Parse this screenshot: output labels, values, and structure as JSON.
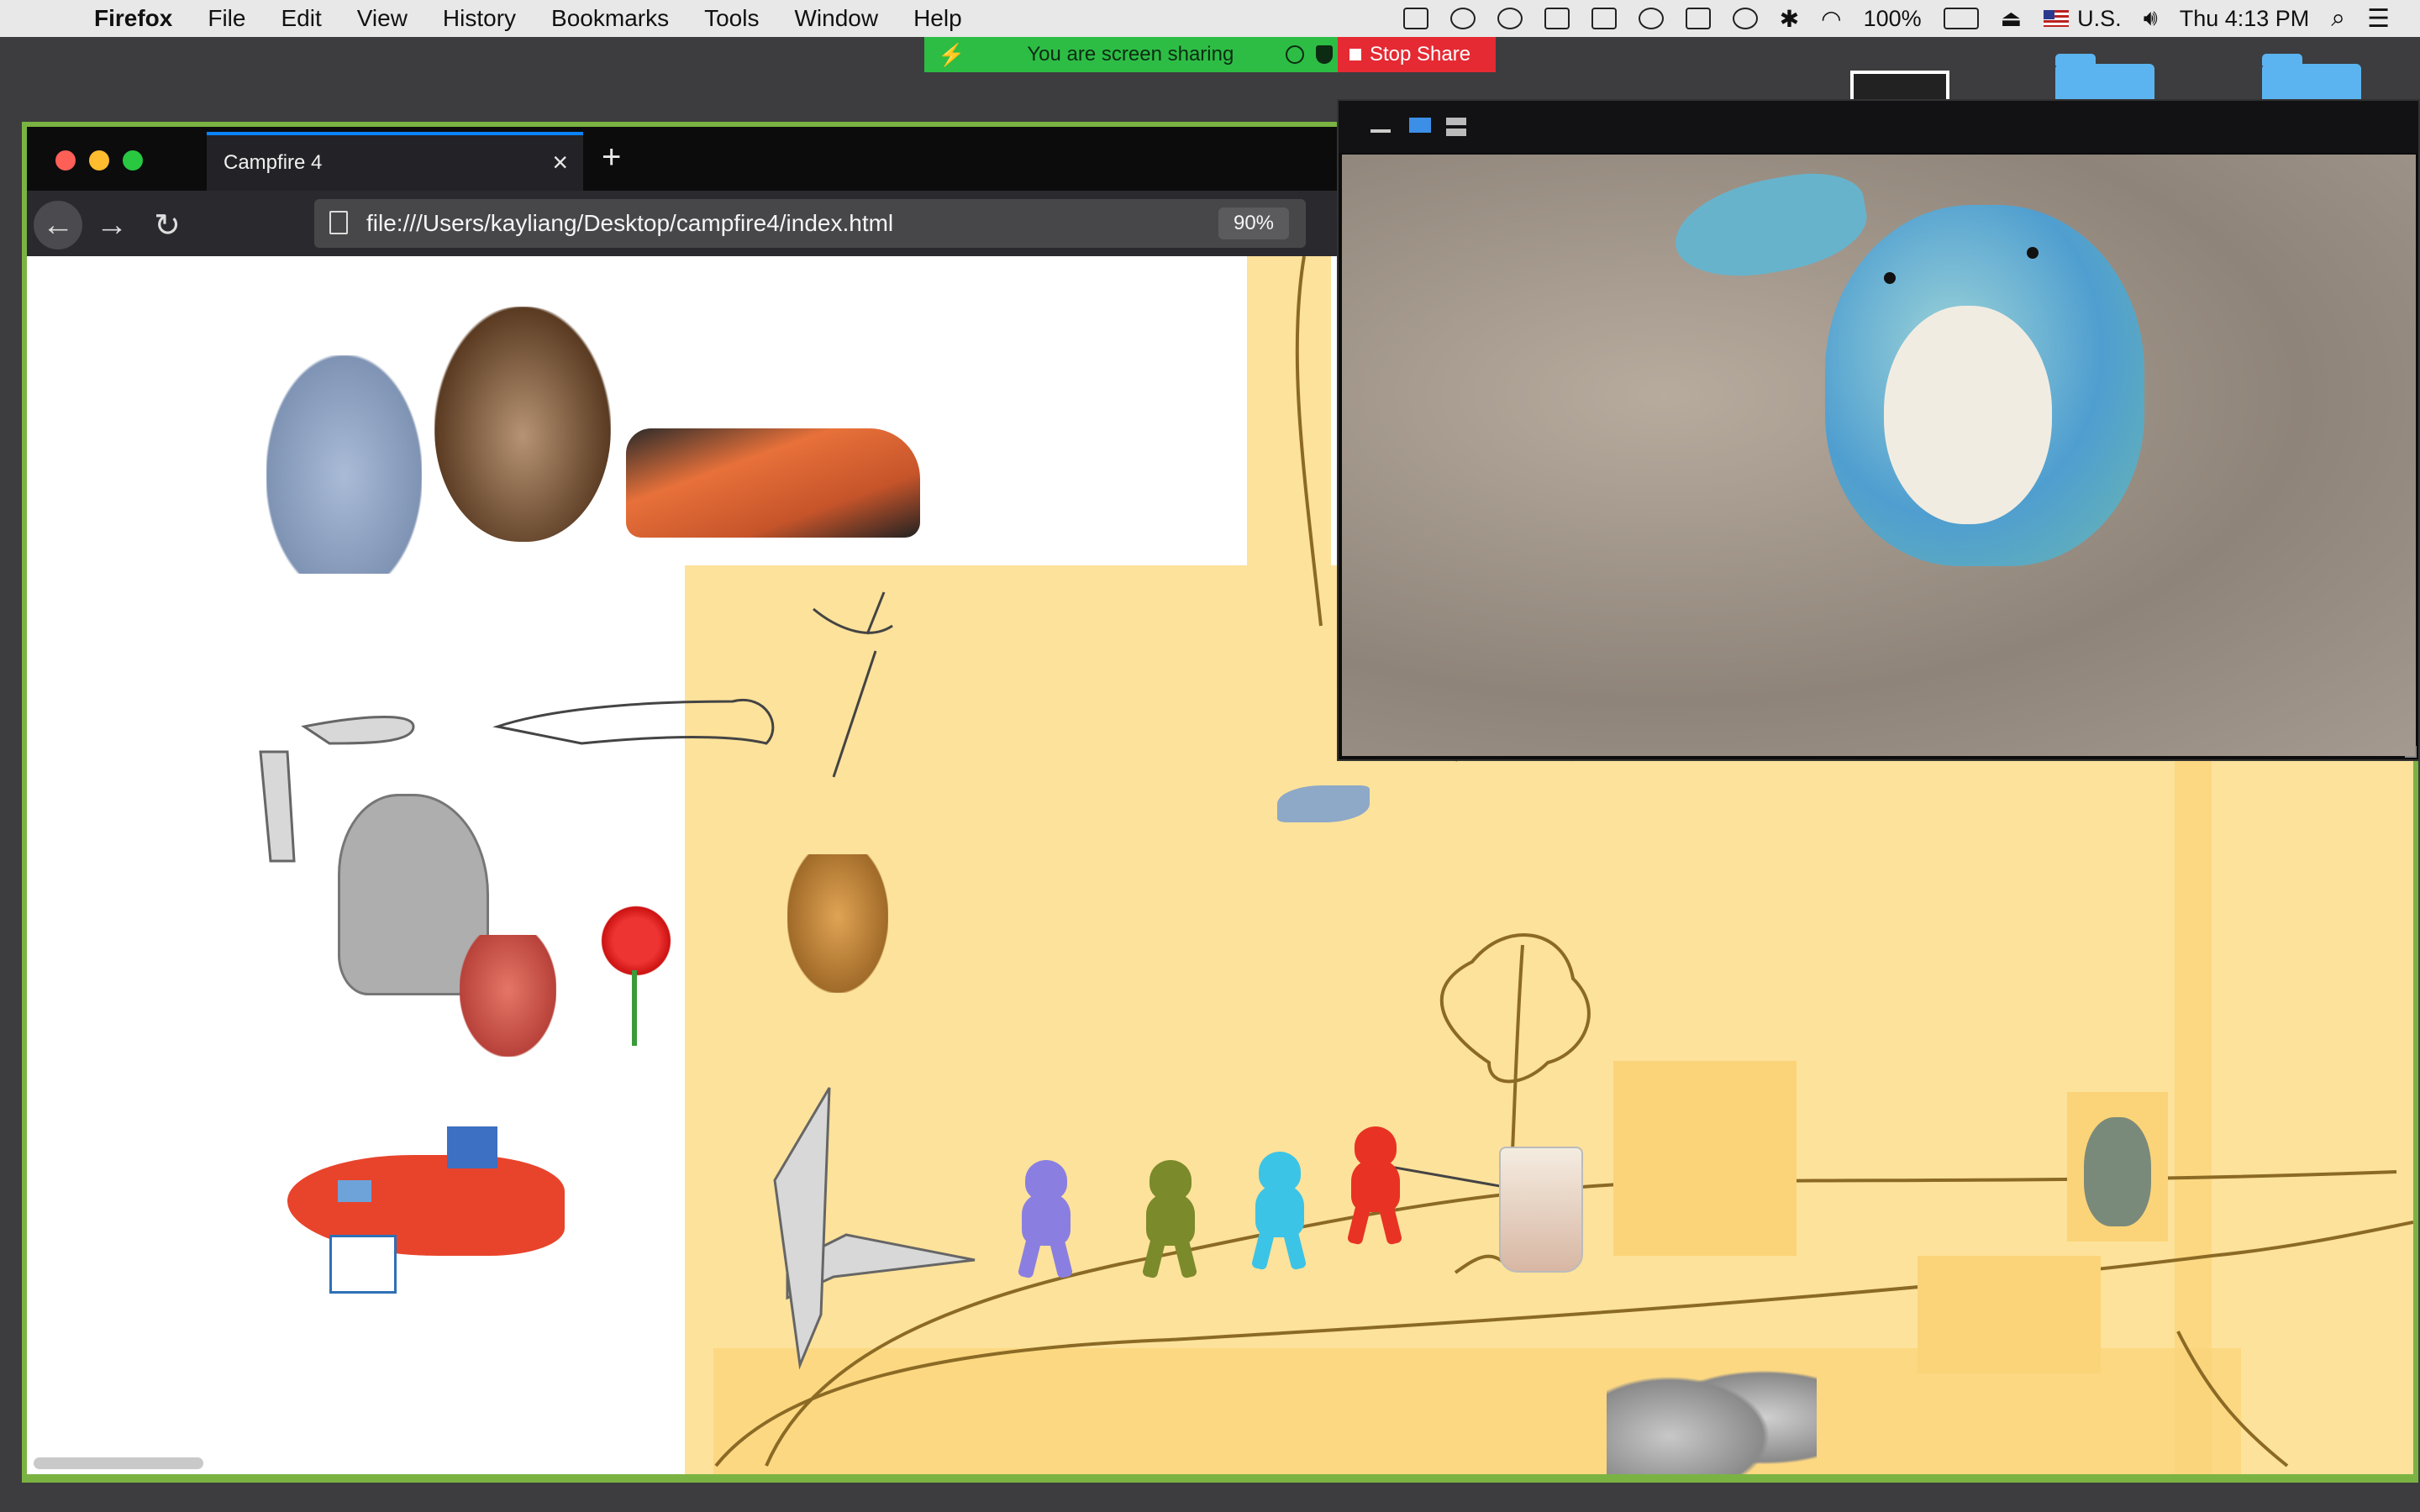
{
  "menubar": {
    "app_name": "Firefox",
    "menus": [
      "File",
      "Edit",
      "View",
      "History",
      "Bookmarks",
      "Tools",
      "Window",
      "Help"
    ],
    "battery": "100%",
    "input_source": "U.S.",
    "clock": "Thu 4:13 PM"
  },
  "sharebar": {
    "status": "You are screen sharing",
    "stop_label": "Stop Share"
  },
  "browser": {
    "tab_title": "Campfire 4",
    "url": "file:///Users/kayliang/Desktop/campfire4/index.html",
    "zoom": "90%"
  },
  "canvas": {
    "stickers": [
      "unicorn-plush",
      "hedgehog-plush",
      "orange-lego-car",
      "paper-dog-drawing",
      "sword-drawing",
      "robot-drawing",
      "unicorn-drawing",
      "red-panda-figure",
      "red-flower-drawing",
      "red-helicopter-drawing",
      "leopard-plush",
      "paper-airplane",
      "bird",
      "four-monsters",
      "tree-drawing",
      "coffee-cup",
      "robot-stick-figure",
      "totoro-figure",
      "dog-drawing",
      "helmets"
    ],
    "monster_colors": [
      "#8a7fe0",
      "#7b8a2a",
      "#3cc4e6",
      "#e83224"
    ]
  },
  "toolbar": {
    "tools": [
      "dice-icon",
      "avatar-wheel-icon",
      "lightbulb-icon",
      "bottle-icon",
      "brush-icon",
      "globe-icon",
      "card-icon",
      "note-card-icon",
      "sketch-card-icon",
      "phone-icon",
      "magnifier-icon",
      "pen-icon",
      "sticky-notes-icon",
      "ball-icon"
    ]
  },
  "colors": {
    "share_green": "#2dbd45",
    "stop_red": "#e52a33",
    "window_green": "#7bb343",
    "canvas_yellow": "#fde29b"
  }
}
